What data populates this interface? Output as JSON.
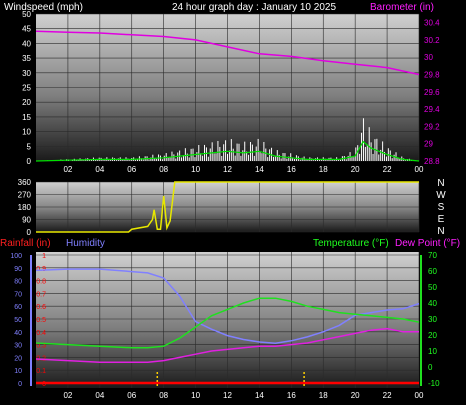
{
  "top": {
    "left_label": "Windspeed (mph)",
    "title": "24 hour graph day : January 10 2025",
    "right_label": "Barometer (in)",
    "left_ticks": [
      "50",
      "45",
      "40",
      "35",
      "30",
      "25",
      "20",
      "15",
      "10",
      "5",
      "0"
    ],
    "right_ticks": [
      "30.4",
      "30.2",
      "30",
      "29.8",
      "29.6",
      "29.4",
      "29.2",
      "29",
      "28.8"
    ]
  },
  "dir": {
    "left_ticks": [
      "360",
      "270",
      "180",
      "90",
      "0"
    ],
    "compass": [
      "N",
      "W",
      "S",
      "E",
      "N"
    ]
  },
  "bottom": {
    "rain_label": "Rainfall (in)",
    "hum_label": "Humidity",
    "temp_label": "Temperature (°F)",
    "dew_label": "Dew Point (°F)",
    "hum_ticks": [
      "100",
      "90",
      "80",
      "70",
      "60",
      "50",
      "40",
      "30",
      "20",
      "10",
      "0"
    ],
    "rain_ticks": [
      "1",
      "0.9",
      "0.8",
      "0.7",
      "0.6",
      "0.5",
      "0.4",
      "0.3",
      "0.2",
      "0.1",
      "0"
    ],
    "temp_ticks": [
      "70",
      "60",
      "50",
      "40",
      "30",
      "20",
      "10",
      "0",
      "-10"
    ]
  },
  "x_ticks": [
    "02",
    "04",
    "06",
    "08",
    "10",
    "12",
    "14",
    "16",
    "18",
    "20",
    "22",
    "00"
  ],
  "colors": {
    "barometer": "#e000e0",
    "wind": "#ffffff",
    "gust": "#00e000",
    "direction": "#e8e800",
    "humidity": "#8080ff",
    "temperature": "#20e020",
    "dewpoint": "#e020e0",
    "rain": "#ff0000",
    "label_left_rain": "#ff2020",
    "label_left_hum": "#8080ff",
    "label_temp": "#20ff20",
    "label_dew": "#ff20ff"
  },
  "chart_data": [
    {
      "type": "line",
      "title": "24 hour graph day : January 10 2025",
      "xlabel": "",
      "series": [
        {
          "name": "Barometer (in)",
          "x": [
            0,
            2,
            4,
            6,
            8,
            10,
            12,
            14,
            16,
            18,
            20,
            22,
            24
          ],
          "values": [
            30.3,
            30.29,
            30.28,
            30.26,
            30.24,
            30.2,
            30.12,
            30.04,
            30.01,
            29.96,
            29.92,
            29.88,
            29.8
          ]
        },
        {
          "name": "Windspeed (mph)",
          "x": [
            0,
            2,
            4,
            6,
            8,
            9,
            10,
            11,
            12,
            13,
            14,
            15,
            16,
            17,
            18,
            19,
            20,
            20.5,
            21,
            22,
            23,
            24
          ],
          "values": [
            0,
            0.5,
            1,
            1,
            2,
            3,
            4,
            5,
            6,
            5,
            6,
            3,
            2,
            1,
            1,
            1,
            3,
            12,
            8,
            4,
            1,
            0
          ]
        }
      ],
      "ylim_left": [
        0,
        50
      ],
      "ylim_right": [
        28.8,
        30.5
      ]
    },
    {
      "type": "line",
      "series": [
        {
          "name": "Wind direction",
          "x": [
            0,
            5.8,
            6,
            7.0,
            7.3,
            7.4,
            7.6,
            7.8,
            8.0,
            8.2,
            8.4,
            8.7,
            9.5,
            24
          ],
          "values": [
            0,
            0,
            20,
            40,
            90,
            160,
            20,
            20,
            260,
            30,
            80,
            360,
            360,
            360
          ]
        }
      ],
      "ylim": [
        0,
        360
      ]
    },
    {
      "type": "line",
      "series": [
        {
          "name": "Humidity",
          "x": [
            0,
            2,
            4,
            6,
            7,
            8,
            9,
            10,
            11,
            12,
            13,
            14,
            15,
            16,
            17,
            18,
            19,
            20,
            21,
            22,
            23,
            24
          ],
          "values": [
            88,
            89,
            89,
            87,
            86,
            82,
            68,
            48,
            42,
            37,
            34,
            32,
            31,
            33,
            36,
            40,
            45,
            53,
            55,
            57,
            58,
            62
          ]
        },
        {
          "name": "Temperature (°F)",
          "x": [
            0,
            2,
            4,
            6,
            7,
            8,
            9,
            10,
            11,
            12,
            13,
            14,
            15,
            16,
            17,
            18,
            19,
            20,
            21,
            22,
            23,
            24
          ],
          "values": [
            15,
            14,
            13,
            12,
            12,
            13,
            18,
            25,
            32,
            36,
            40,
            43,
            43,
            41,
            38,
            36,
            34,
            33,
            32,
            31,
            30,
            28
          ]
        },
        {
          "name": "Dew Point (°F)",
          "x": [
            0,
            2,
            4,
            6,
            7,
            8,
            9,
            10,
            11,
            12,
            13,
            14,
            15,
            16,
            17,
            18,
            19,
            20,
            21,
            22,
            23,
            24
          ],
          "values": [
            5,
            4,
            3,
            3,
            3,
            4,
            6,
            8,
            10,
            11,
            12,
            13,
            13,
            14,
            15,
            17,
            19,
            21,
            23,
            24,
            22,
            22
          ]
        },
        {
          "name": "Rainfall (in)",
          "x": [
            0,
            24
          ],
          "values": [
            0,
            0
          ]
        }
      ],
      "ylim_left": [
        0,
        100
      ],
      "ylim_temp": [
        -10,
        70
      ],
      "ylim_rain": [
        0,
        1
      ]
    }
  ]
}
